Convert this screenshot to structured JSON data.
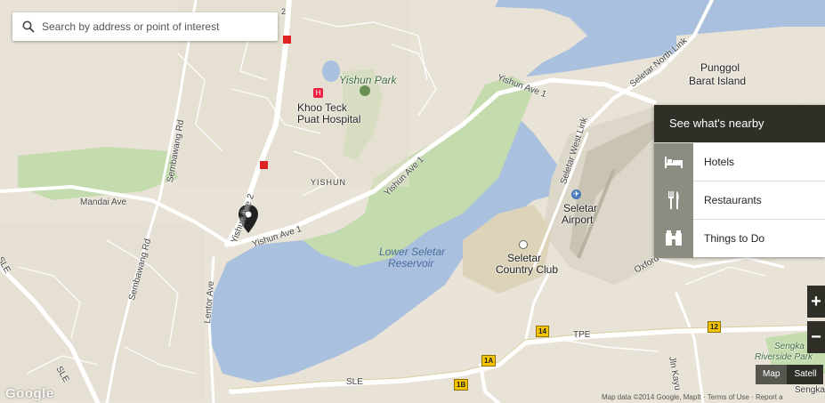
{
  "search": {
    "placeholder": "Search by address or point of interest"
  },
  "nearby": {
    "title": "See what's nearby",
    "items": [
      {
        "label": "Hotels",
        "icon": "bed-icon"
      },
      {
        "label": "Restaurants",
        "icon": "fork-knife-icon"
      },
      {
        "label": "Things to Do",
        "icon": "binoculars-icon"
      }
    ]
  },
  "zoom": {
    "in": "+",
    "out": "−"
  },
  "map_type": {
    "map": "Map",
    "satellite": "Satell"
  },
  "branding": {
    "logo": "Google",
    "attribution": "Map data ©2014 Google, MapIt · Terms of Use · Report a"
  },
  "colors": {
    "land": "#e8e3d6",
    "water": "#a9c0df",
    "park": "#c3dbad",
    "road": "#ffffff",
    "panel_dark": "#2f2f28",
    "shield": "#f4c400"
  },
  "places": {
    "punggol": "Punggol",
    "barat_island": "Barat Island",
    "yishun_park": "Yishun Park",
    "khoo_teck": "Khoo Teck",
    "puat_hospital": "Puat Hospital",
    "yishun": "YISHUN",
    "reservoir_1": "Lower Seletar",
    "reservoir_2": "Reservoir",
    "seletar": "Seletar",
    "airport": "Airport",
    "country_1": "Seletar",
    "country_2": "Country Club",
    "sengkang_1": "Sengka",
    "sengkang_2": "Riverside Park",
    "sengkang_3": "Sengka"
  },
  "roads": {
    "seletar_north_link": "Seletar North Link",
    "yishun_ave1_top": "Yishun Ave 1",
    "yishun_ave1_mid": "Yishun Ave 1",
    "yishun_ave1_low": "Yishun Ave 1",
    "yishun_ave2": "Yishun Ave 2",
    "sembawang_rd_top": "Sembawang Rd",
    "sembawang_rd_low": "Sembawang Rd",
    "mandai_ave": "Mandai Ave",
    "sle_left": "SLE",
    "sle_mid": "SLE",
    "sle_low": "SLE",
    "lentor_ave": "Lentor Ave",
    "seletar_west_link": "Seletar West Link",
    "oxford": "Oxford",
    "tpe": "TPE",
    "jln_kayu": "Jln Kayu",
    "e2": "2"
  },
  "shields": {
    "s14": "14",
    "s12": "12",
    "s1a": "1A",
    "s1b": "1B"
  }
}
